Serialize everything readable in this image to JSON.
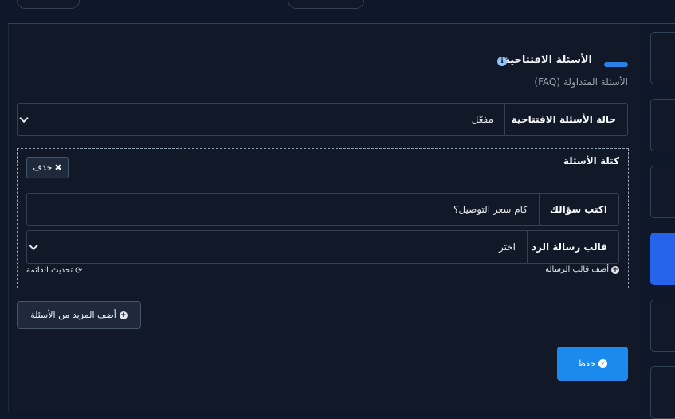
{
  "section": {
    "title": "الأسئلة الافتتاحية",
    "subtitle": "الأسئلة المتداولة (FAQ)",
    "info_icon": "ℹ",
    "accent_color": "#2b7fe5"
  },
  "status_row": {
    "label": "حالة الأسئلة الافتتاحية",
    "value": "مفعّل"
  },
  "faq_block": {
    "title": "كتلة الأسئلة",
    "delete_label": "حذف",
    "question": {
      "label": "اكتب سؤالك",
      "value": "كام سعر التوصيل؟"
    },
    "reply_template": {
      "label": "قالب رسالة الرد",
      "value": "اختر"
    },
    "add_template_label": "أضف قالب الرسالة",
    "refresh_list_label": "تحديث القائمة"
  },
  "add_more_label": "أضف المزيد من الأسئلة",
  "save_label": "حفظ",
  "colors": {
    "background": "#111827",
    "save_button": "#1b8aee",
    "active_tab": "#2563eb"
  }
}
